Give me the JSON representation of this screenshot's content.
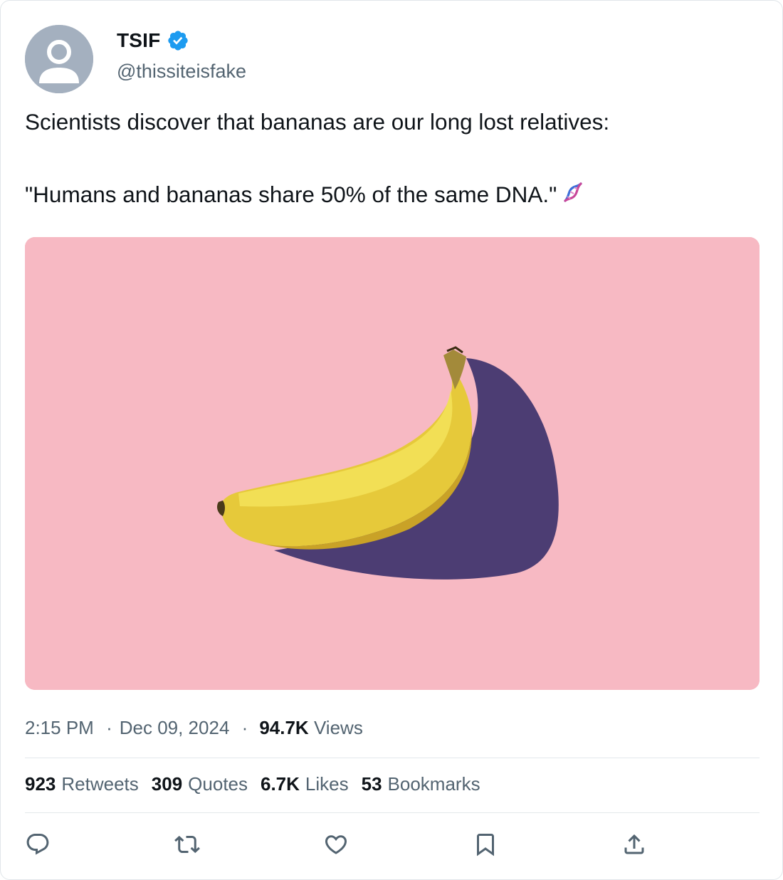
{
  "author": {
    "display_name": "TSIF",
    "handle": "@thissiteisfake",
    "verified_icon": "verified-badge-icon",
    "avatar_icon": "default-avatar-icon"
  },
  "tweet": {
    "line1": "Scientists discover that bananas are our long lost relatives:",
    "line2": "\"Humans and bananas share 50% of the same DNA.\"",
    "emoji_icon": "dna-icon"
  },
  "media": {
    "icon": "banana-photo",
    "background_color": "#f7b9c3"
  },
  "meta": {
    "time": "2:15 PM",
    "separator": "·",
    "date": "Dec 09, 2024",
    "views_count": "94.7K",
    "views_label": "Views"
  },
  "stats": [
    {
      "count": "923",
      "label": "Retweets"
    },
    {
      "count": "309",
      "label": "Quotes"
    },
    {
      "count": "6.7K",
      "label": "Likes"
    },
    {
      "count": "53",
      "label": "Bookmarks"
    }
  ],
  "actions": [
    {
      "name": "reply",
      "icon": "reply-icon"
    },
    {
      "name": "retweet",
      "icon": "retweet-icon"
    },
    {
      "name": "like",
      "icon": "heart-icon"
    },
    {
      "name": "bookmark",
      "icon": "bookmark-icon"
    },
    {
      "name": "share",
      "icon": "share-icon"
    }
  ],
  "colors": {
    "text": "#0f1419",
    "secondary_text": "#536471",
    "verified_blue": "#1d9bf0",
    "divider": "#e3e8eb",
    "avatar_bg": "#a4b0bf"
  }
}
